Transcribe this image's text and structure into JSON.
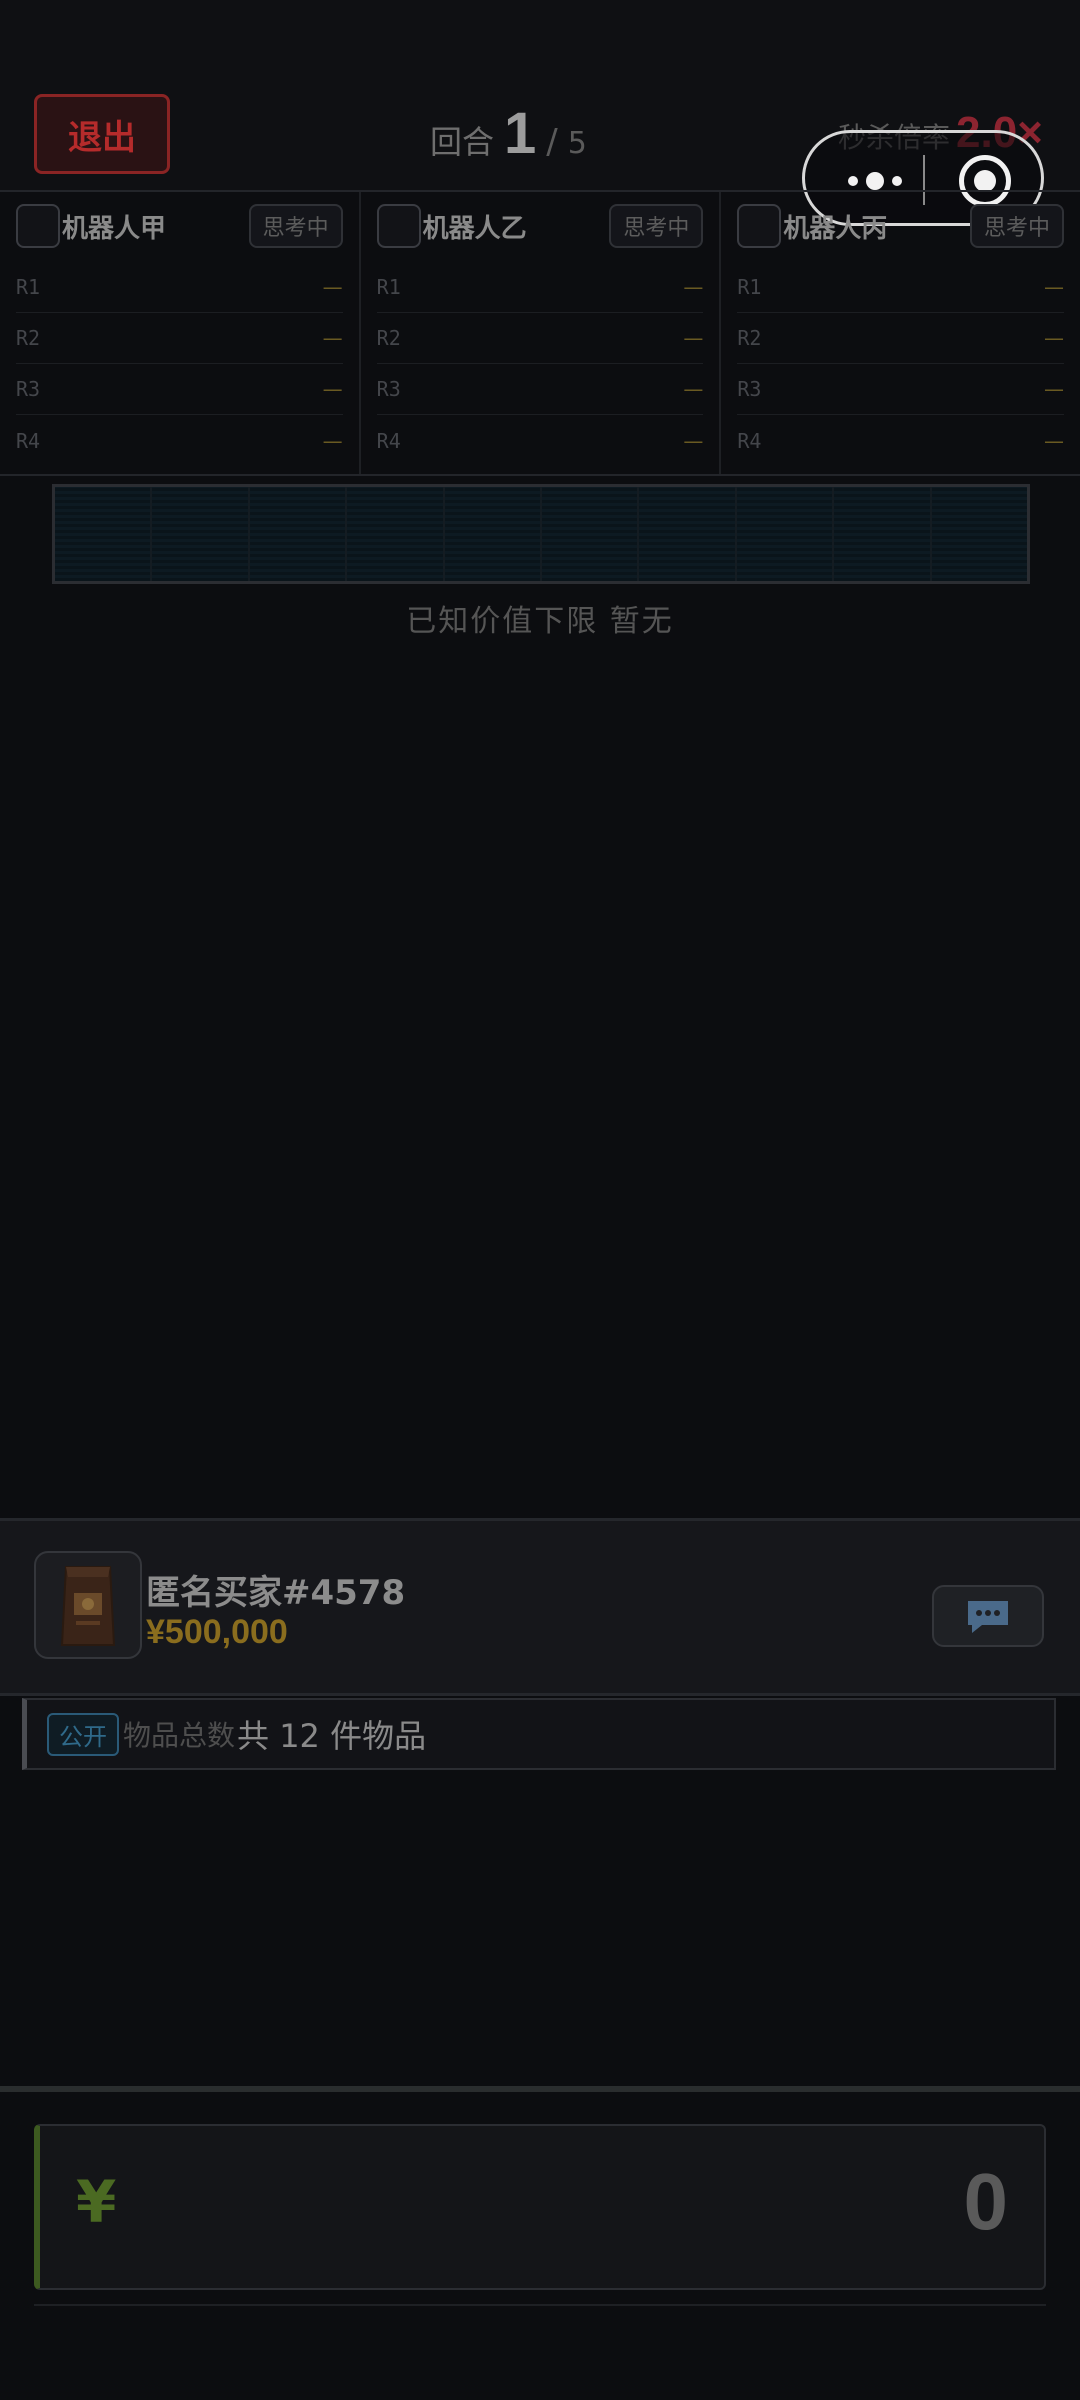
{
  "header": {
    "exit_label": "退出",
    "round_label": "回合",
    "round_current": "1",
    "round_sep": "/",
    "round_total": "5",
    "multiplier_label": "秒杀倍率",
    "multiplier_value": "2.0×"
  },
  "robots": [
    {
      "name": "机器人甲",
      "status": "思考中",
      "rows": [
        {
          "label": "R1",
          "value": "—"
        },
        {
          "label": "R2",
          "value": "—"
        },
        {
          "label": "R3",
          "value": "—"
        },
        {
          "label": "R4",
          "value": "—"
        }
      ]
    },
    {
      "name": "机器人乙",
      "status": "思考中",
      "rows": [
        {
          "label": "R1",
          "value": "—"
        },
        {
          "label": "R2",
          "value": "—"
        },
        {
          "label": "R3",
          "value": "—"
        },
        {
          "label": "R4",
          "value": "—"
        }
      ]
    },
    {
      "name": "机器人丙",
      "status": "思考中",
      "rows": [
        {
          "label": "R1",
          "value": "—"
        },
        {
          "label": "R2",
          "value": "—"
        },
        {
          "label": "R3",
          "value": "—"
        },
        {
          "label": "R4",
          "value": "—"
        }
      ]
    }
  ],
  "known_floor_text": "已知价值下限 暂无",
  "seller": {
    "buyer_name": "匿名买家#4578",
    "buyer_price": "¥500,000",
    "item_icon": "coffee-bag-icon",
    "chat_icon": "chat-bubble-icon"
  },
  "info": {
    "tag": "公开",
    "label": "物品总数",
    "value": "共 12 件物品"
  },
  "bid": {
    "currency": "¥",
    "value": "0"
  },
  "colors": {
    "exit_red": "#b52b2b",
    "multiplier_red": "#8c2430",
    "price_gold": "#8a6d1e",
    "bid_green": "#4b6a22",
    "tag_blue": "#2f6a8a"
  }
}
